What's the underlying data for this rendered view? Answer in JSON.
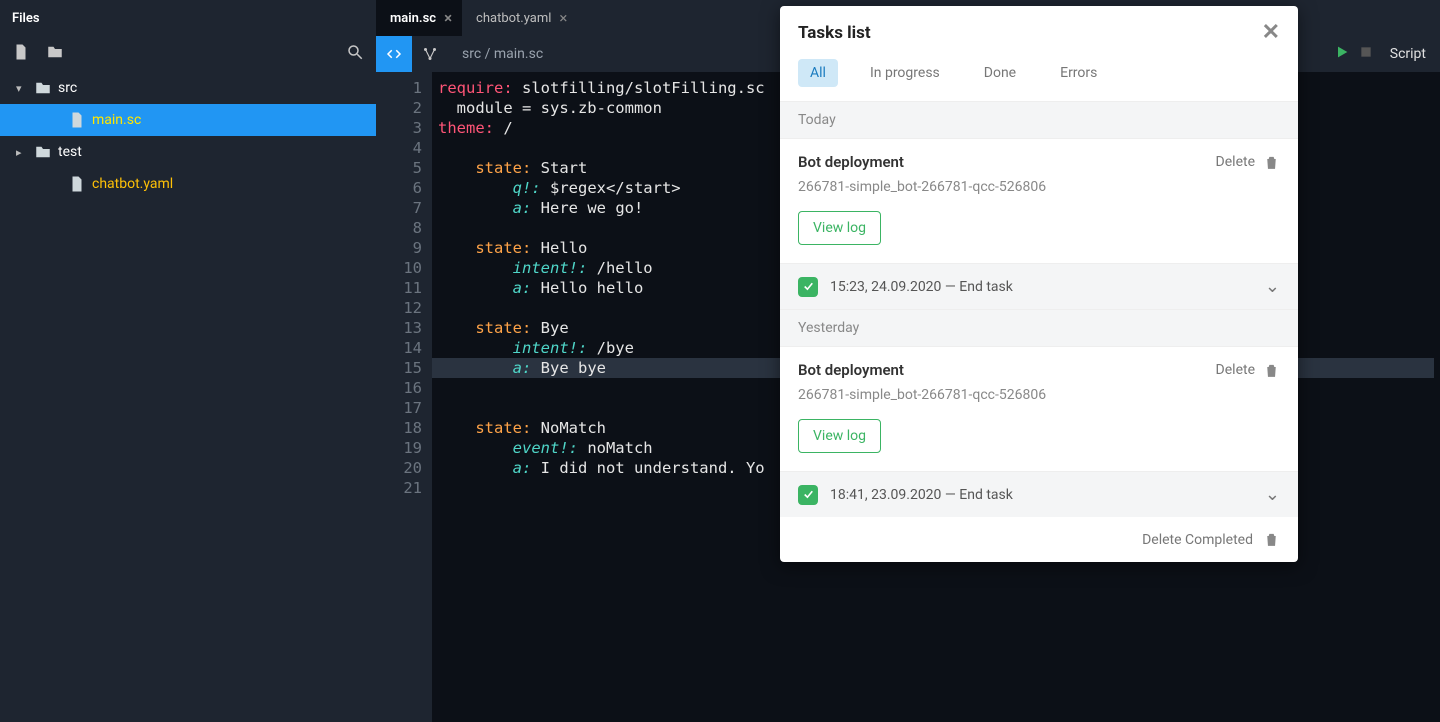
{
  "sidebar": {
    "title": "Files",
    "tree": [
      {
        "kind": "folder",
        "label": "src",
        "expanded": true,
        "indent": 0
      },
      {
        "kind": "file",
        "label": "main.sc",
        "style": "main",
        "indent": 1,
        "selected": true
      },
      {
        "kind": "folder",
        "label": "test",
        "expanded": false,
        "indent": 0
      },
      {
        "kind": "file",
        "label": "chatbot.yaml",
        "style": "yaml",
        "indent": 1
      }
    ]
  },
  "tabs": [
    {
      "label": "main.sc",
      "active": true
    },
    {
      "label": "chatbot.yaml",
      "active": false
    }
  ],
  "breadcrumb": "src / main.sc",
  "script_label": "Script",
  "code_lines": [
    [
      [
        "kw-red",
        "require:"
      ],
      [
        "txt",
        " slotfilling/slotFilling.sc"
      ]
    ],
    [
      [
        "txt",
        "  module = sys.zb-common"
      ]
    ],
    [
      [
        "kw-red",
        "theme:"
      ],
      [
        "txt",
        " /"
      ]
    ],
    [],
    [
      [
        "txt",
        "    "
      ],
      [
        "kw-orange",
        "state:"
      ],
      [
        "txt",
        " Start"
      ]
    ],
    [
      [
        "txt",
        "        "
      ],
      [
        "kw-teal",
        "q!:"
      ],
      [
        "txt",
        " $regex</start>"
      ]
    ],
    [
      [
        "txt",
        "        "
      ],
      [
        "kw-teal",
        "a:"
      ],
      [
        "txt",
        " Here we go!"
      ]
    ],
    [],
    [
      [
        "txt",
        "    "
      ],
      [
        "kw-orange",
        "state:"
      ],
      [
        "txt",
        " Hello"
      ]
    ],
    [
      [
        "txt",
        "        "
      ],
      [
        "kw-teal",
        "intent!:"
      ],
      [
        "txt",
        " /hello"
      ]
    ],
    [
      [
        "txt",
        "        "
      ],
      [
        "kw-teal",
        "a:"
      ],
      [
        "txt",
        " Hello hello"
      ]
    ],
    [],
    [
      [
        "txt",
        "    "
      ],
      [
        "kw-orange",
        "state:"
      ],
      [
        "txt",
        " Bye"
      ]
    ],
    [
      [
        "txt",
        "        "
      ],
      [
        "kw-teal",
        "intent!:"
      ],
      [
        "txt",
        " /bye"
      ]
    ],
    [
      [
        "txt",
        "        "
      ],
      [
        "kw-teal",
        "a:"
      ],
      [
        "txt",
        " Bye bye"
      ]
    ],
    [],
    [
      [
        "txt",
        "    "
      ],
      [
        "kw-orange",
        "state:"
      ],
      [
        "txt",
        " NoMatch"
      ]
    ],
    [
      [
        "txt",
        "        "
      ],
      [
        "kw-teal",
        "event!:"
      ],
      [
        "txt",
        " noMatch"
      ]
    ],
    [
      [
        "txt",
        "        "
      ],
      [
        "kw-teal",
        "a:"
      ],
      [
        "txt",
        " I did not understand. Yo"
      ]
    ],
    [],
    []
  ],
  "highlight_line": 15,
  "tasks": {
    "title": "Tasks list",
    "filters": [
      "All",
      "In progress",
      "Done",
      "Errors"
    ],
    "active_filter": 0,
    "sections": [
      {
        "label": "Today",
        "task": {
          "title": "Bot deployment",
          "subtitle": "266781-simple_bot-266781-qcc-526806",
          "view_log": "View log",
          "delete": "Delete",
          "meta": "15:23, 24.09.2020 — End task"
        }
      },
      {
        "label": "Yesterday",
        "task": {
          "title": "Bot deployment",
          "subtitle": "266781-simple_bot-266781-qcc-526806",
          "view_log": "View log",
          "delete": "Delete",
          "meta": "18:41, 23.09.2020 — End task"
        }
      }
    ],
    "footer": "Delete Completed"
  }
}
